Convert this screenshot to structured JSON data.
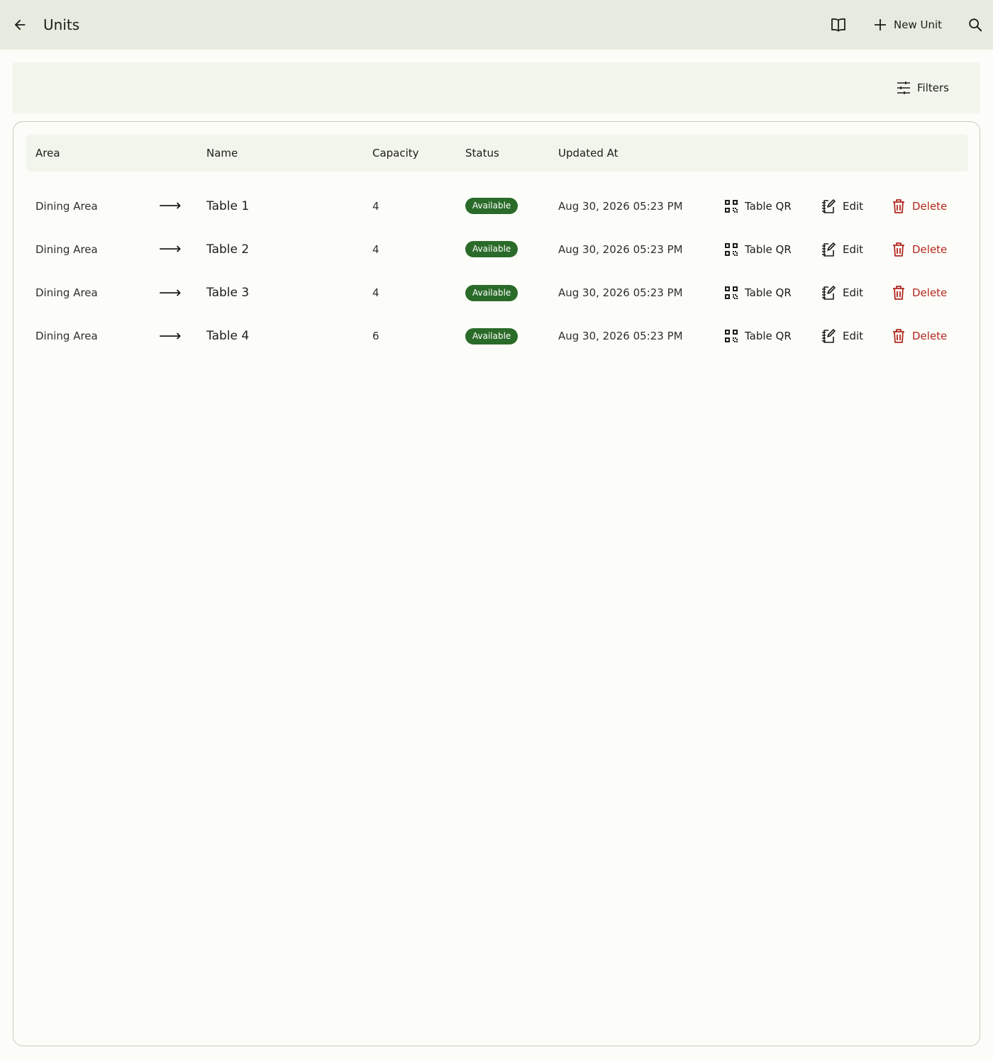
{
  "header": {
    "title": "Units",
    "new_unit_label": "New Unit"
  },
  "filters": {
    "label": "Filters"
  },
  "table": {
    "columns": [
      "Area",
      "Name",
      "Capacity",
      "Status",
      "Updated At"
    ],
    "rows": [
      {
        "area": "Dining Area",
        "name": "Table 1",
        "capacity": "4",
        "status": "Available",
        "updated_at": "Aug 30, 2026 05:23 PM"
      },
      {
        "area": "Dining Area",
        "name": "Table 2",
        "capacity": "4",
        "status": "Available",
        "updated_at": "Aug 30, 2026 05:23 PM"
      },
      {
        "area": "Dining Area",
        "name": "Table 3",
        "capacity": "4",
        "status": "Available",
        "updated_at": "Aug 30, 2026 05:23 PM"
      },
      {
        "area": "Dining Area",
        "name": "Table 4",
        "capacity": "6",
        "status": "Available",
        "updated_at": "Aug 30, 2026 05:23 PM"
      }
    ],
    "actions": {
      "qr_label": "Table QR",
      "edit_label": "Edit",
      "delete_label": "Delete"
    },
    "arrow_glyph": "⟶"
  },
  "colors": {
    "topbar_bg": "#e6ebe0",
    "page_bg": "#fcfdf8",
    "status_available": "#2a6b29",
    "delete": "#b3261e"
  }
}
